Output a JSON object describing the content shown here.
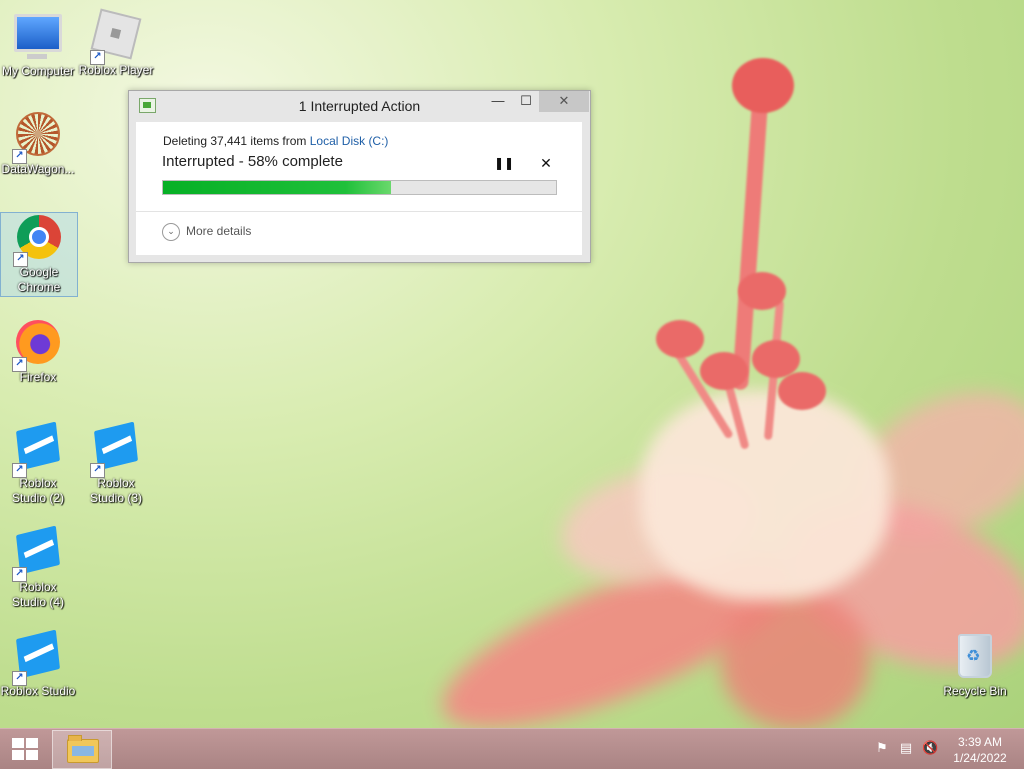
{
  "desktop": {
    "icons": [
      {
        "label": "My Computer"
      },
      {
        "label": "Roblox Player"
      },
      {
        "label": "DataWagon..."
      },
      {
        "label": "Google Chrome"
      },
      {
        "label": "Firefox"
      },
      {
        "label": "Roblox Studio (2)"
      },
      {
        "label": "Roblox Studio (3)"
      },
      {
        "label": "Roblox Studio (4)"
      },
      {
        "label": "Roblox Studio"
      },
      {
        "label": "Recycle Bin"
      }
    ]
  },
  "dialog": {
    "title": "1 Interrupted Action",
    "operation_prefix": "Deleting 37,441 items from ",
    "location_link": "Local Disk (C:)",
    "status": "Interrupted - 58% complete",
    "progress_percent": 58,
    "pause_glyph": "❚❚",
    "cancel_glyph": "✕",
    "more_details": "More details",
    "min_glyph": "—",
    "max_glyph": "☐",
    "close_glyph": "✕",
    "chevron_glyph": "⌄"
  },
  "taskbar": {
    "time": "3:39 AM",
    "date": "1/24/2022",
    "tray_icons": [
      "action-center-flag-icon",
      "network-icon",
      "volume-muted-icon"
    ]
  },
  "colors": {
    "progress_fill": "#06b025",
    "link": "#1f5fa7",
    "taskbar": "#b08a8a"
  }
}
